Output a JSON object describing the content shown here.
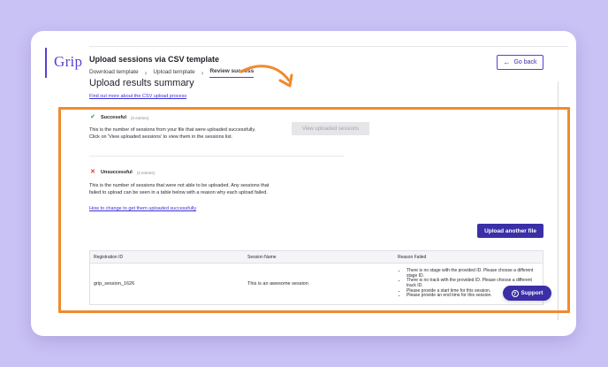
{
  "app": {
    "logo": "Grip"
  },
  "header": {
    "title": "Upload sessions via CSV template",
    "back_label": "Go back"
  },
  "breadcrumb": [
    {
      "label": "Download template"
    },
    {
      "label": "Upload template"
    },
    {
      "label": "Review success"
    }
  ],
  "main": {
    "heading": "Upload results summary",
    "help_link": "Find out more about the CSV upload process",
    "successful": {
      "label": "Successful",
      "count": "(0 entries)",
      "description": "This is the number of sessions from your file that were uploaded successfully. Click on 'View uploaded sessions' to view them in the sessions list.",
      "view_button": "View uploaded sessions"
    },
    "unsuccessful": {
      "label": "Unsuccessful",
      "count": "(3 entries)",
      "description": "This is the number of sessions that were not able to be uploaded. Any sessions that failed to upload can be seen in a table below with a reason why each upload failed.",
      "help_link": "How to change to get them uploaded successfully"
    },
    "upload_button": "Upload another file",
    "table": {
      "headers": [
        "Registration ID",
        "Session Name",
        "Reason Failed"
      ],
      "rows": [
        {
          "registration_id": "grip_session_1626",
          "session_name": "This is an awesome session",
          "reasons": [
            "There is no stage with the provided ID. Please choose a different stage ID.",
            "There is no track with the provided ID. Please choose a different track ID.",
            "Please provide a start time for this session.",
            "Please provide an end time for this session."
          ]
        }
      ]
    }
  },
  "support": {
    "label": "Support"
  },
  "icons": {
    "back": "arrow-left-icon",
    "success": "check-icon",
    "failure": "x-icon",
    "support": "question-icon"
  },
  "colors": {
    "brand": "#5b3fd6",
    "button": "#3b2fa8",
    "highlight": "#f18a2d",
    "background": "#c9c2f5"
  }
}
